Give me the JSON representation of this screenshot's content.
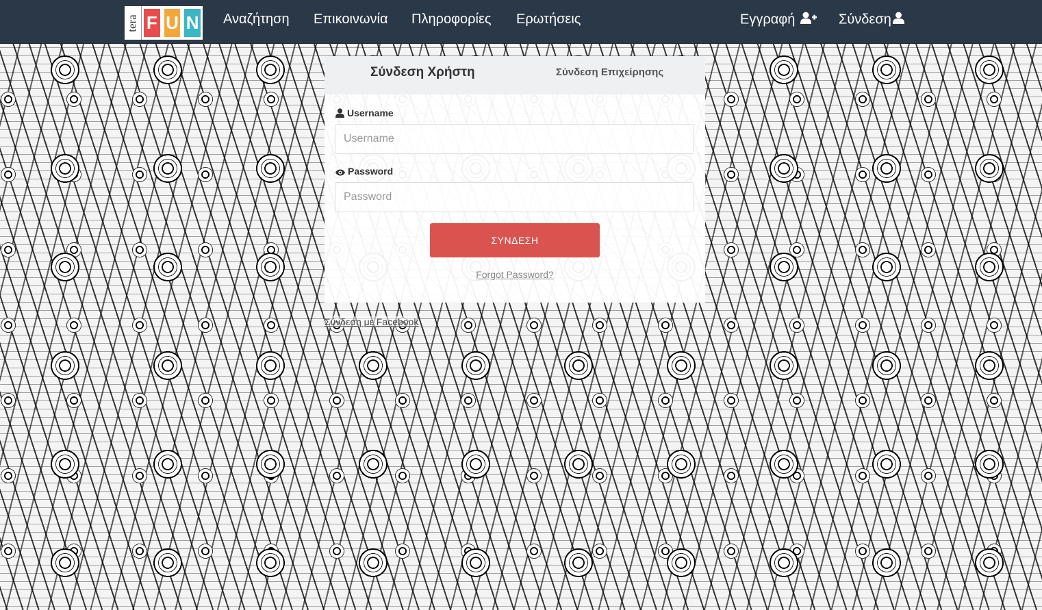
{
  "brand": {
    "logo_prefix": "tera",
    "logo_letters": [
      "F",
      "U",
      "N"
    ],
    "logo_colors": [
      "#e84c4c",
      "#f3a73b",
      "#3bb6c4"
    ]
  },
  "nav": {
    "links": [
      "Αναζήτηση",
      "Επικοινωνία",
      "Πληροφορίες",
      "Ερωτήσεις"
    ],
    "register": "Εγγραφή",
    "login": "Σύνδεση",
    "register_icon": "user-plus-icon",
    "login_icon": "user-icon"
  },
  "login_panel": {
    "tab_user": "Σύνδεση Χρήστη",
    "tab_business": "Σύνδεση Επιχείρησης",
    "username_label": "Username",
    "username_placeholder": "Username",
    "username_value": "",
    "password_label": "Password",
    "password_placeholder": "Password",
    "password_value": "",
    "submit_label": "ΣΥΝΔΕΣΗ",
    "forgot_label": "Forgot Password?"
  },
  "footer_link": "Σύνδεση με Facebook",
  "colors": {
    "navbar": "#2b3848",
    "button": "#d9534f",
    "panel_tabs": "#eef0f1"
  }
}
